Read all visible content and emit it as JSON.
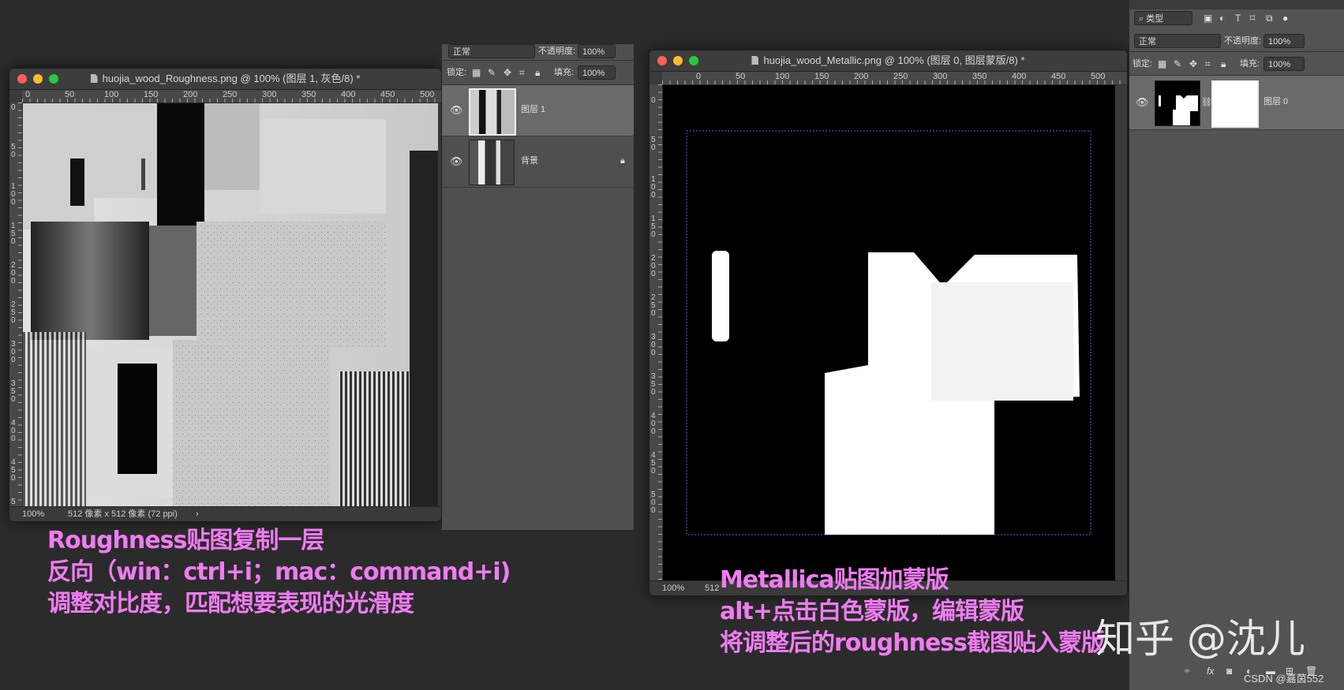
{
  "roughness_window": {
    "title": "huojia_wood_Roughness.png @ 100% (图层 1, 灰色/8) *",
    "ruler_ticks": [
      "0",
      "50",
      "100",
      "150",
      "200",
      "250",
      "300",
      "350",
      "400",
      "450",
      "500"
    ],
    "vruler_ticks": [
      "0",
      "50",
      "100",
      "150",
      "200",
      "250",
      "300",
      "350",
      "400",
      "450",
      "500"
    ],
    "zoom": "100%",
    "doc_info": "512 像素 x 512 像素 (72 ppi)",
    "chevron": "›"
  },
  "layers_panel_left": {
    "blend_mode": "正常",
    "opacity_label": "不透明度:",
    "opacity_value": "100%",
    "lock_label": "锁定:",
    "fill_label": "填充:",
    "fill_value": "100%",
    "layers": [
      {
        "name": "图层 1",
        "visible": true,
        "selected": true
      },
      {
        "name": "背景",
        "visible": true,
        "locked": true
      }
    ]
  },
  "metallic_window": {
    "title": "huojia_wood_Metallic.png @ 100% (图层 0, 图层蒙版/8) *",
    "ruler_ticks": [
      "0",
      "50",
      "100",
      "150",
      "200",
      "250",
      "300",
      "350",
      "400",
      "450",
      "500"
    ],
    "vruler_ticks": [
      "0",
      "50",
      "100",
      "150",
      "200",
      "250",
      "300",
      "350",
      "400",
      "450",
      "500"
    ],
    "zoom": "100%",
    "doc_info": "512"
  },
  "layers_panel_right": {
    "filter_label": "类型",
    "blend_mode": "正常",
    "opacity_label": "不透明度:",
    "opacity_value": "100%",
    "lock_label": "锁定:",
    "fill_label": "填充:",
    "fill_value": "100%",
    "layers": [
      {
        "name": "图层 0",
        "visible": true,
        "selected": true,
        "has_mask": true
      }
    ],
    "footer_icons": [
      "link-icon",
      "fx-icon",
      "mask-icon",
      "adjustment-icon",
      "folder-icon",
      "new-layer-icon",
      "trash-icon"
    ],
    "fx_label": "fx"
  },
  "annotations_left": [
    "Roughness贴图复制一层",
    "反向（win：ctrl+i；mac：command+i)",
    "调整对比度，匹配想要表现的光滑度"
  ],
  "annotations_right": [
    "Metallica贴图加蒙版",
    "alt+点击白色蒙版，编辑蒙版",
    "将调整后的roughness截图贴入蒙版"
  ],
  "watermark_zhihu": "知乎 @沈儿",
  "watermark_csdn": "CSDN @嘉茵552",
  "colors": {
    "annotation": "#ef7cf2",
    "panel_bg": "#4f4f4f",
    "selected_row": "#6a6a6a",
    "page_bg": "#2b2b2b"
  }
}
